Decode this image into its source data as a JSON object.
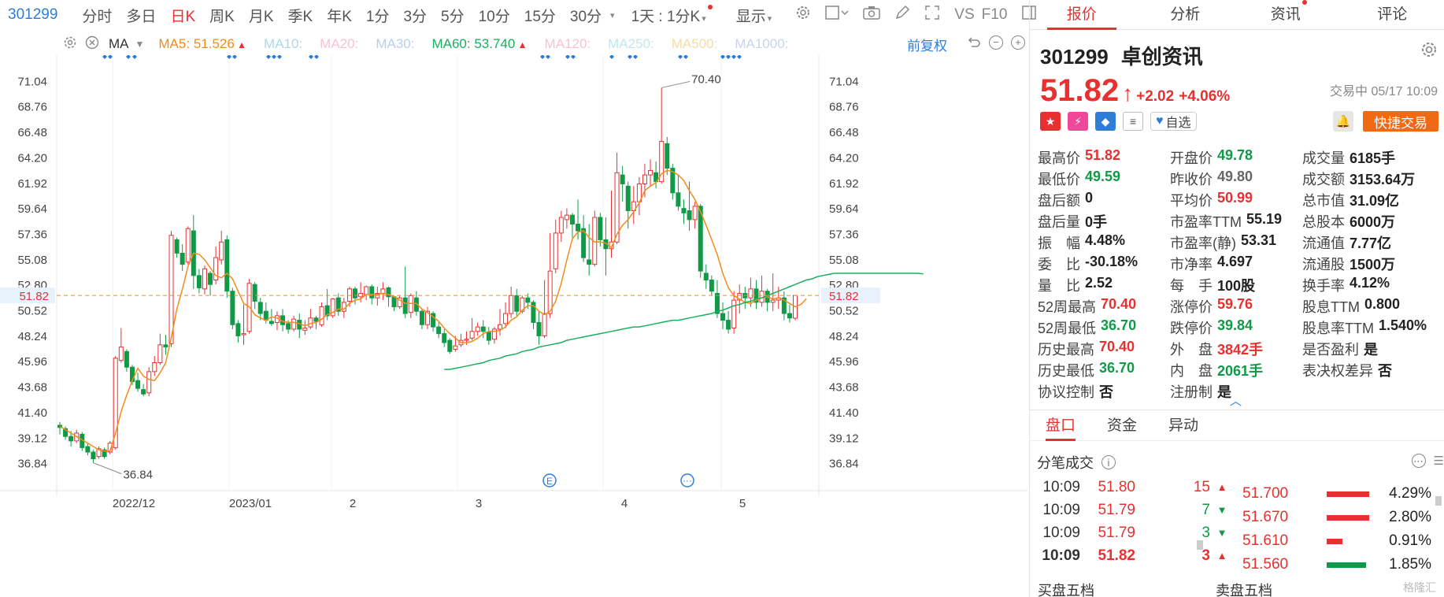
{
  "toolbar": {
    "code": "301299",
    "items": [
      "分时",
      "多日",
      "日K",
      "周K",
      "月K",
      "季K",
      "年K",
      "1分",
      "3分",
      "5分",
      "10分",
      "15分",
      "30分"
    ],
    "active_index": 2,
    "period_select": "1天 : 1分K",
    "display_label": "显示",
    "vs_label": "VS",
    "f10_label": "F10"
  },
  "ma_row": {
    "type_label": "MA",
    "ma5_label": "MA5:",
    "ma5_value": "51.526",
    "ma10_label": "MA10:",
    "ma20_label": "MA20:",
    "ma30_label": "MA30:",
    "ma60_label": "MA60:",
    "ma60_value": "53.740",
    "ma120_label": "MA120:",
    "ma250_label": "MA250:",
    "ma500_label": "MA500:",
    "ma1000_label": "MA1000:",
    "adjust_label": "前复权"
  },
  "chart_data": {
    "type": "candlestick",
    "y_ticks": [
      "71.04",
      "68.76",
      "66.48",
      "64.20",
      "61.92",
      "59.64",
      "57.36",
      "55.08",
      "52.80",
      "50.52",
      "48.24",
      "45.96",
      "43.68",
      "41.40",
      "39.12",
      "36.84"
    ],
    "ylim": [
      34.56,
      73.32
    ],
    "x_labels": [
      "2022/12",
      "2023/01",
      "2",
      "3",
      "4",
      "5"
    ],
    "current_price": "51.82",
    "max_label": "70.40",
    "min_label": "36.84",
    "candles": [
      [
        40.2,
        40.0,
        39.4,
        40.5
      ],
      [
        39.9,
        39.2,
        38.9,
        40.1
      ],
      [
        39.2,
        38.8,
        38.3,
        39.7
      ],
      [
        38.8,
        39.5,
        38.6,
        39.8
      ],
      [
        39.4,
        38.2,
        37.9,
        39.6
      ],
      [
        38.3,
        37.8,
        37.5,
        38.6
      ],
      [
        37.8,
        37.2,
        36.84,
        38.0
      ],
      [
        37.4,
        38.1,
        37.2,
        38.3
      ],
      [
        38.0,
        37.4,
        37.2,
        38.2
      ],
      [
        37.8,
        38.6,
        37.6,
        38.8
      ],
      [
        38.2,
        46.2,
        38.0,
        46.4
      ],
      [
        46.0,
        47.2,
        45.8,
        48.9
      ],
      [
        46.8,
        45.4,
        45.0,
        47.0
      ],
      [
        45.4,
        44.1,
        43.8,
        45.6
      ],
      [
        44.2,
        43.5,
        43.2,
        44.9
      ],
      [
        43.4,
        43.0,
        42.8,
        43.9
      ],
      [
        43.1,
        45.0,
        42.8,
        45.4
      ],
      [
        45.0,
        45.8,
        44.6,
        46.4
      ],
      [
        45.8,
        47.4,
        45.6,
        48.4
      ],
      [
        47.4,
        47.2,
        46.5,
        48.3
      ],
      [
        47.5,
        57.2,
        47.2,
        57.6
      ],
      [
        56.8,
        55.6,
        55.2,
        57.0
      ],
      [
        55.6,
        54.6,
        54.0,
        56.4
      ],
      [
        54.8,
        57.8,
        54.6,
        58.0
      ],
      [
        57.6,
        53.6,
        52.4,
        59.0
      ],
      [
        53.6,
        52.5,
        52.0,
        54.2
      ],
      [
        52.4,
        54.2,
        51.9,
        54.5
      ],
      [
        53.8,
        52.8,
        51.8,
        54.0
      ],
      [
        53.2,
        55.2,
        52.8,
        56.2
      ],
      [
        55.0,
        56.6,
        54.6,
        57.6
      ],
      [
        56.8,
        52.2,
        51.6,
        57.2
      ],
      [
        52.2,
        49.2,
        48.8,
        52.5
      ],
      [
        49.3,
        48.2,
        47.6,
        49.6
      ],
      [
        48.3,
        48.4,
        47.4,
        51.0
      ],
      [
        48.6,
        52.9,
        48.4,
        53.3
      ],
      [
        52.8,
        51.3,
        50.6,
        53.0
      ],
      [
        51.2,
        50.2,
        49.6,
        51.6
      ],
      [
        50.4,
        49.6,
        49.3,
        51.2
      ],
      [
        49.5,
        49.3,
        49.1,
        50.6
      ],
      [
        49.4,
        50.0,
        48.7,
        50.4
      ],
      [
        50.0,
        49.2,
        48.6,
        50.6
      ],
      [
        49.3,
        48.8,
        48.4,
        49.6
      ],
      [
        48.8,
        49.7,
        48.6,
        50.0
      ],
      [
        49.6,
        48.8,
        48.0,
        50.2
      ],
      [
        48.7,
        48.9,
        48.3,
        49.6
      ],
      [
        49.0,
        49.8,
        48.8,
        50.6
      ],
      [
        49.8,
        49.5,
        48.8,
        50.0
      ],
      [
        49.2,
        50.8,
        49.0,
        51.2
      ],
      [
        50.9,
        50.0,
        49.6,
        52.4
      ],
      [
        50.0,
        51.5,
        49.8,
        51.6
      ],
      [
        51.6,
        50.4,
        50.0,
        52.0
      ],
      [
        50.4,
        51.2,
        49.8,
        51.6
      ],
      [
        51.3,
        52.4,
        50.8,
        52.6
      ],
      [
        52.4,
        51.6,
        51.0,
        52.6
      ],
      [
        51.7,
        52.0,
        51.2,
        53.0
      ],
      [
        51.9,
        52.6,
        51.4,
        52.7
      ],
      [
        52.6,
        51.6,
        51.0,
        52.8
      ],
      [
        51.6,
        52.0,
        50.9,
        52.6
      ],
      [
        52.0,
        52.4,
        51.4,
        53.0
      ],
      [
        52.5,
        51.7,
        50.8,
        52.6
      ],
      [
        51.7,
        50.8,
        50.4,
        51.8
      ],
      [
        50.8,
        51.6,
        50.6,
        51.8
      ],
      [
        51.6,
        50.2,
        49.8,
        54.4
      ],
      [
        50.3,
        51.8,
        49.8,
        52.0
      ],
      [
        51.6,
        50.4,
        50.0,
        52.2
      ],
      [
        50.4,
        49.2,
        48.8,
        50.6
      ],
      [
        49.2,
        50.4,
        48.8,
        50.8
      ],
      [
        50.2,
        49.0,
        48.6,
        50.4
      ],
      [
        49.0,
        48.4,
        48.0,
        49.4
      ],
      [
        48.4,
        47.6,
        47.2,
        48.8
      ],
      [
        47.8,
        46.8,
        46.6,
        48.0
      ],
      [
        47.0,
        47.3,
        46.8,
        48.2
      ],
      [
        47.4,
        47.8,
        47.2,
        48.4
      ],
      [
        47.8,
        47.9,
        47.4,
        48.6
      ],
      [
        48.0,
        48.6,
        47.8,
        49.8
      ],
      [
        48.6,
        49.0,
        48.2,
        49.4
      ],
      [
        49.0,
        48.6,
        48.0,
        49.6
      ],
      [
        48.5,
        47.8,
        47.4,
        49.0
      ],
      [
        47.9,
        48.8,
        47.5,
        49.0
      ],
      [
        48.8,
        49.2,
        48.2,
        50.6
      ],
      [
        49.3,
        50.2,
        48.9,
        51.2
      ],
      [
        50.2,
        51.8,
        49.8,
        52.6
      ],
      [
        51.8,
        50.4,
        50.0,
        52.4
      ],
      [
        50.4,
        51.6,
        50.2,
        51.8
      ],
      [
        51.6,
        51.2,
        50.6,
        52.0
      ],
      [
        51.2,
        49.4,
        48.8,
        51.4
      ],
      [
        49.4,
        48.2,
        47.4,
        50.4
      ],
      [
        48.2,
        50.2,
        48.0,
        53.2
      ],
      [
        50.2,
        54.0,
        49.8,
        57.4
      ],
      [
        54.2,
        57.4,
        53.8,
        58.6
      ],
      [
        57.4,
        58.8,
        56.6,
        59.4
      ],
      [
        58.6,
        59.0,
        57.8,
        59.6
      ],
      [
        59.0,
        58.2,
        57.0,
        59.2
      ],
      [
        58.2,
        57.6,
        56.8,
        60.4
      ],
      [
        57.8,
        55.2,
        54.8,
        59.0
      ],
      [
        55.0,
        54.6,
        53.6,
        58.2
      ],
      [
        54.6,
        58.8,
        54.4,
        59.4
      ],
      [
        58.8,
        56.8,
        56.2,
        59.2
      ],
      [
        56.8,
        56.0,
        53.6,
        58.8
      ],
      [
        56.0,
        56.6,
        55.2,
        61.2
      ],
      [
        56.6,
        62.8,
        56.4,
        64.6
      ],
      [
        62.6,
        61.8,
        60.2,
        63.4
      ],
      [
        61.6,
        59.4,
        57.8,
        62.0
      ],
      [
        59.4,
        60.2,
        58.2,
        61.6
      ],
      [
        60.2,
        61.8,
        59.0,
        62.4
      ],
      [
        61.8,
        62.6,
        60.6,
        63.6
      ],
      [
        62.6,
        63.0,
        61.6,
        64.0
      ],
      [
        62.8,
        62.0,
        61.4,
        63.8
      ],
      [
        62.0,
        65.6,
        61.8,
        70.4
      ],
      [
        65.4,
        63.2,
        62.6,
        66.0
      ],
      [
        63.2,
        61.0,
        60.4,
        63.6
      ],
      [
        61.0,
        59.8,
        59.4,
        62.6
      ],
      [
        59.6,
        59.2,
        58.2,
        60.4
      ],
      [
        59.4,
        58.6,
        57.6,
        62.0
      ],
      [
        58.6,
        59.8,
        57.8,
        60.2
      ],
      [
        59.8,
        54.0,
        53.4,
        60.0
      ],
      [
        53.8,
        53.2,
        52.4,
        54.6
      ],
      [
        53.2,
        52.2,
        51.8,
        53.6
      ],
      [
        52.0,
        50.2,
        49.8,
        53.2
      ],
      [
        50.2,
        49.6,
        48.8,
        51.2
      ],
      [
        49.6,
        48.8,
        48.4,
        50.4
      ],
      [
        48.9,
        51.4,
        48.4,
        52.2
      ],
      [
        51.4,
        52.0,
        50.2,
        52.8
      ],
      [
        52.0,
        51.6,
        50.6,
        52.6
      ],
      [
        51.6,
        52.4,
        50.8,
        53.4
      ],
      [
        52.4,
        51.2,
        50.6,
        53.2
      ],
      [
        51.2,
        52.2,
        50.8,
        53.6
      ],
      [
        52.2,
        51.2,
        50.4,
        52.4
      ],
      [
        51.2,
        51.4,
        50.4,
        53.8
      ],
      [
        51.4,
        51.6,
        50.6,
        52.6
      ],
      [
        51.6,
        50.2,
        49.6,
        52.2
      ],
      [
        50.2,
        49.8,
        49.4,
        51.0
      ],
      [
        49.78,
        51.82,
        49.59,
        51.82
      ]
    ],
    "ma5": [
      40.1,
      39.8,
      39.5,
      39.2,
      38.9,
      38.6,
      38.3,
      38.0,
      37.9,
      37.9,
      39.5,
      41.4,
      42.9,
      44.2,
      45.3,
      44.6,
      44.3,
      44.2,
      44.9,
      45.8,
      48.0,
      50.6,
      52.4,
      54.4,
      55.6,
      55.5,
      55.0,
      54.3,
      53.6,
      53.4,
      53.8,
      53.3,
      52.2,
      51.1,
      50.8,
      50.1,
      49.8,
      49.6,
      49.9,
      49.8,
      49.5,
      49.4,
      49.4,
      49.3,
      49.1,
      49.3,
      49.4,
      49.7,
      50.1,
      50.3,
      50.6,
      50.6,
      51.1,
      51.4,
      51.5,
      51.9,
      51.9,
      51.9,
      52.0,
      51.9,
      51.7,
      51.4,
      51.1,
      51.1,
      51.1,
      50.6,
      50.3,
      49.9,
      49.5,
      48.9,
      48.4,
      48.0,
      47.6,
      47.6,
      47.7,
      48.0,
      48.4,
      48.6,
      48.6,
      48.7,
      49.0,
      49.6,
      49.9,
      50.5,
      50.9,
      50.9,
      50.4,
      50.1,
      50.4,
      51.3,
      52.9,
      55.0,
      56.9,
      57.5,
      57.6,
      57.0,
      56.6,
      56.6,
      56.5,
      56.1,
      57.3,
      58.1,
      58.6,
      59.3,
      60.1,
      61.2,
      61.6,
      61.9,
      62.7,
      63.0,
      62.9,
      62.6,
      62.1,
      61.2,
      60.4,
      59.3,
      58.1,
      56.8,
      55.5,
      53.8,
      52.5,
      51.8,
      51.5,
      51.2,
      51.1,
      51.4,
      51.6,
      51.7,
      51.5,
      51.6,
      51.4,
      51.1,
      50.8,
      51.0,
      51.526
    ],
    "ma60_start_index": 49,
    "ma60": [
      45.2,
      45.2,
      45.3,
      45.4,
      45.5,
      45.6,
      45.7,
      45.8,
      46.0,
      46.1,
      46.2,
      46.4,
      46.5,
      46.6,
      46.8,
      46.9,
      47.0,
      47.2,
      47.3,
      47.4,
      47.5,
      47.6,
      47.8,
      47.9,
      48.0,
      48.1,
      48.2,
      48.3,
      48.4,
      48.5,
      48.6,
      48.7,
      48.8,
      48.9,
      49.0,
      49.0,
      49.1,
      49.2,
      49.3,
      49.4,
      49.5,
      49.6,
      49.6,
      49.7,
      49.8,
      49.9,
      50.0,
      50.1,
      50.2,
      50.4,
      50.5,
      50.7,
      50.9,
      51.0,
      51.2,
      51.3,
      51.5,
      51.6,
      51.8,
      52.0,
      52.2,
      52.4,
      52.6,
      52.8,
      53.0,
      53.2,
      53.3,
      53.5,
      53.6,
      53.7,
      53.8,
      53.8,
      53.8,
      53.8,
      53.8,
      53.8,
      53.8,
      53.8,
      53.8,
      53.8,
      53.8,
      53.8,
      53.8,
      53.8,
      53.8,
      53.8,
      53.74
    ]
  },
  "panel": {
    "tabs": [
      "报价",
      "分析",
      "资讯",
      "评论"
    ],
    "code": "301299",
    "name": "卓创资讯",
    "price": "51.82",
    "change": "+2.02",
    "change_pct": "+4.06%",
    "status": "交易中 05/17 10:09",
    "watch_label": "自选",
    "quick_trade": "快捷交易",
    "stats": [
      [
        [
          "最高价",
          "51.82",
          "red"
        ],
        [
          "开盘价",
          "49.78",
          "green"
        ],
        [
          "成交量",
          "6185手",
          "blk"
        ]
      ],
      [
        [
          "最低价",
          "49.59",
          "green"
        ],
        [
          "昨收价",
          "49.80",
          "grey"
        ],
        [
          "成交额",
          "3153.64万",
          "blk"
        ]
      ],
      [
        [
          "盘后额",
          "0",
          "blk"
        ],
        [
          "平均价",
          "50.99",
          "red"
        ],
        [
          "总市值",
          "31.09亿",
          "blk"
        ]
      ],
      [
        [
          "盘后量",
          "0手",
          "blk"
        ],
        [
          "市盈率TTM",
          "55.19",
          "blk"
        ],
        [
          "总股本",
          "6000万",
          "blk"
        ]
      ],
      [
        [
          "振　幅",
          "4.48%",
          "blk"
        ],
        [
          "市盈率(静)",
          "53.31",
          "blk"
        ],
        [
          "流通值",
          "7.77亿",
          "blk"
        ]
      ],
      [
        [
          "委　比",
          "-30.18%",
          "blk"
        ],
        [
          "市净率",
          "4.697",
          "blk"
        ],
        [
          "流通股",
          "1500万",
          "blk"
        ]
      ],
      [
        [
          "量　比",
          "2.52",
          "blk"
        ],
        [
          "每　手",
          "100股",
          "blk"
        ],
        [
          "换手率",
          "4.12%",
          "blk"
        ]
      ],
      [
        [
          "52周最高",
          "70.40",
          "red"
        ],
        [
          "涨停价",
          "59.76",
          "red"
        ],
        [
          "股息TTM",
          "0.800",
          "blk"
        ]
      ],
      [
        [
          "52周最低",
          "36.70",
          "green"
        ],
        [
          "跌停价",
          "39.84",
          "green"
        ],
        [
          "股息率TTM",
          "1.540%",
          "blk"
        ]
      ],
      [
        [
          "历史最高",
          "70.40",
          "red"
        ],
        [
          "外　盘",
          "3842手",
          "red"
        ],
        [
          "是否盈利",
          "是",
          "blk"
        ]
      ],
      [
        [
          "历史最低",
          "36.70",
          "green"
        ],
        [
          "内　盘",
          "2061手",
          "green"
        ],
        [
          "表决权差异",
          "否",
          "blk"
        ]
      ],
      [
        [
          "协议控制",
          "否",
          "blk"
        ],
        [
          "注册制",
          "是",
          "blk"
        ],
        [
          "",
          "",
          "blk"
        ]
      ]
    ],
    "subtabs": [
      "盘口",
      "资金",
      "异动"
    ],
    "split_title": "分笔成交",
    "ticks": [
      [
        "10:09",
        "51.80",
        "15",
        "up"
      ],
      [
        "10:09",
        "51.79",
        "7",
        "down"
      ],
      [
        "10:09",
        "51.79",
        "3",
        "down"
      ],
      [
        "10:09",
        "51.82",
        "3",
        "up"
      ]
    ],
    "levels": [
      [
        "51.700",
        "4.29%",
        "#e93030",
        0.54
      ],
      [
        "51.670",
        "2.80%",
        "#e93030",
        0.54
      ],
      [
        "51.610",
        "0.91%",
        "#e93030",
        0.2
      ],
      [
        "51.560",
        "1.85%",
        "#109a48",
        0.5
      ]
    ],
    "bid_label": "买盘五档",
    "ask_label": "卖盘五档",
    "watermark": "格隆汇"
  }
}
